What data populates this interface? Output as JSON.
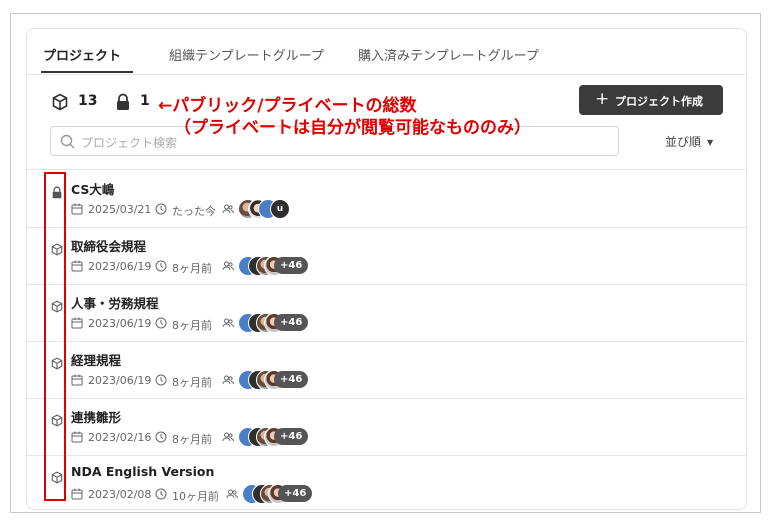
{
  "tabs": [
    {
      "label": "プロジェクト",
      "active": true
    },
    {
      "label": "組織テンプレートグループ",
      "active": false
    },
    {
      "label": "購入済みテンプレートグループ",
      "active": false
    }
  ],
  "stats": {
    "public_count": "13",
    "private_count": "1",
    "public_icon": "cube-icon",
    "private_icon": "lock-icon"
  },
  "toolbar": {
    "create_label": "プロジェクト作成",
    "create_icon": "plus-icon",
    "search_placeholder": "プロジェクト検索",
    "sort_label": "並び順",
    "sort_icon": "caret-down-icon"
  },
  "projects": [
    {
      "name": "CS大嶋",
      "icon": "lock-icon",
      "date": "2025/03/21",
      "time": "たった今",
      "more": "",
      "last_avatar": "u"
    },
    {
      "name": "取締役会規程",
      "icon": "cube-icon",
      "date": "2023/06/19",
      "time": "8ヶ月前",
      "more": "+46",
      "last_avatar": ""
    },
    {
      "name": "人事・労務規程",
      "icon": "cube-icon",
      "date": "2023/06/19",
      "time": "8ヶ月前",
      "more": "+46",
      "last_avatar": ""
    },
    {
      "name": "経理規程",
      "icon": "cube-icon",
      "date": "2023/06/19",
      "time": "8ヶ月前",
      "more": "+46",
      "last_avatar": ""
    },
    {
      "name": "連携雛形",
      "icon": "cube-icon",
      "date": "2023/02/16",
      "time": "8ヶ月前",
      "more": "+46",
      "last_avatar": ""
    },
    {
      "name": "NDA English Version",
      "icon": "cube-icon",
      "date": "2023/02/08",
      "time": "10ヶ月前",
      "more": "+46",
      "last_avatar": ""
    }
  ],
  "annotation": {
    "line1": "←パブリック/プライベートの総数",
    "line2": "（プライベートは自分が閲覧可能なもののみ）"
  },
  "colors": {
    "accent_dark": "#3b3b3b",
    "annotation_red": "#e00000",
    "avatar_blue": "#4a7fc7"
  }
}
